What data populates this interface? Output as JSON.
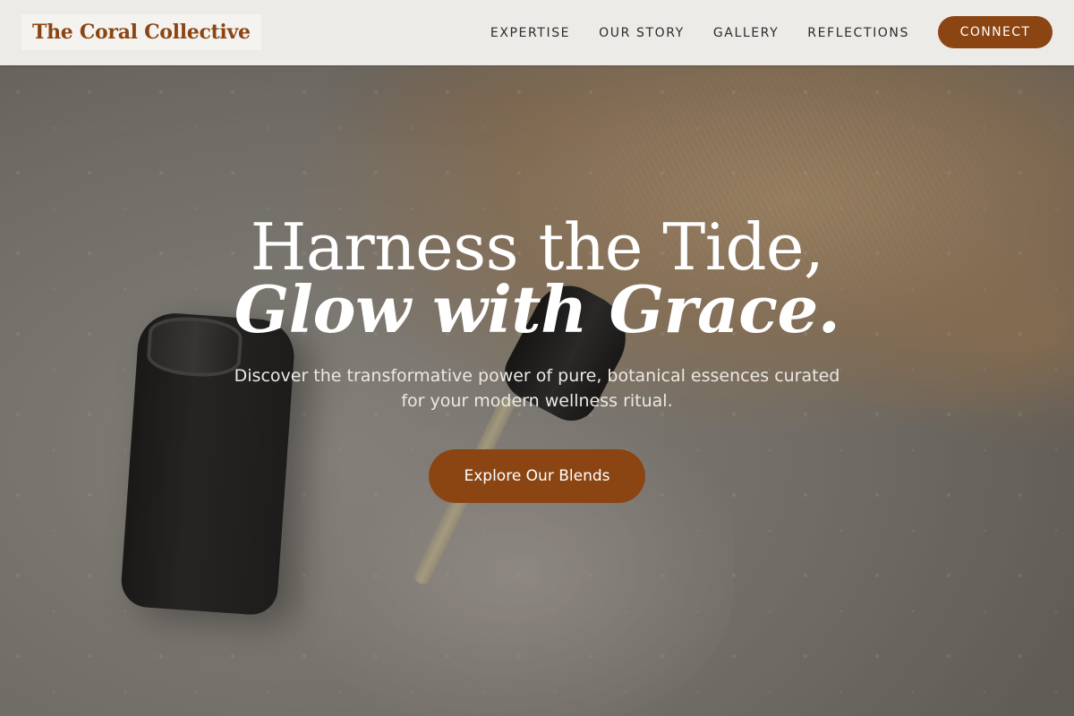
{
  "nav": {
    "logo": "The Coral Collective",
    "links": [
      {
        "label": "EXPERTISE"
      },
      {
        "label": "OUR STORY"
      },
      {
        "label": "GALLERY"
      },
      {
        "label": "REFLECTIONS"
      }
    ],
    "cta_label": "CONNECT"
  },
  "hero": {
    "title_line1": "Harness the Tide,",
    "title_line2": "Glow with Grace.",
    "subtitle": "Discover the transformative power of pure, botanical essences curated for your modern wellness ritual.",
    "cta_label": "Explore Our Blends"
  },
  "colors": {
    "brand": "#8b4513",
    "nav_background": "#ecebe7",
    "hero_text": "#ffffff"
  }
}
